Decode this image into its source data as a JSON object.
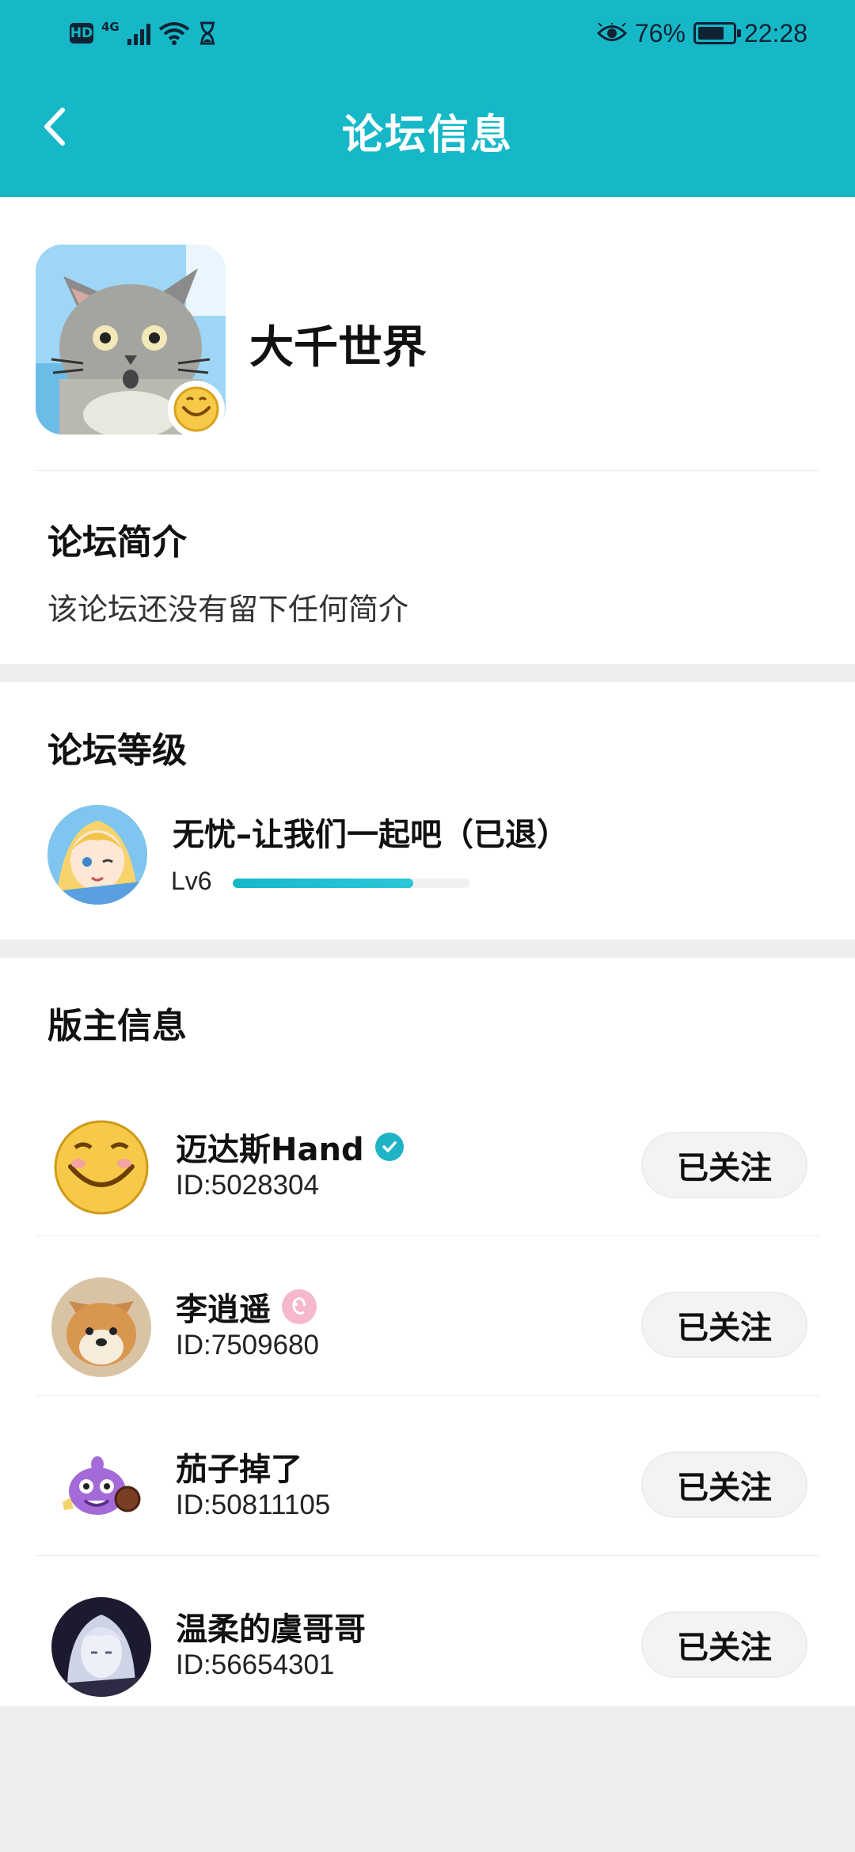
{
  "status_bar": {
    "left_badge": "HD",
    "network": "4G",
    "battery_percent_label": "76%",
    "time": "22:28",
    "battery_level": 0.76
  },
  "header": {
    "title": "论坛信息"
  },
  "forum": {
    "name": "大千世界"
  },
  "intro": {
    "title": "论坛简介",
    "text": "该论坛还没有留下任何简介"
  },
  "level": {
    "title": "论坛等级",
    "name": "无忧–让我们一起吧（已退）",
    "label": "Lv6",
    "progress": 0.76
  },
  "moderators": {
    "title": "版主信息",
    "items": [
      {
        "name": "迈达斯Hand",
        "id": "ID:5028304",
        "button": "已关注",
        "badge": "verified-icon"
      },
      {
        "name": "李逍遥",
        "id": "ID:7509680",
        "button": "已关注",
        "badge": "pink-badge-icon"
      },
      {
        "name": "茄子掉了",
        "id": "ID:50811105",
        "button": "已关注",
        "badge": ""
      },
      {
        "name": "温柔的虞哥哥",
        "id": "ID:56654301",
        "button": "已关注",
        "badge": ""
      }
    ]
  },
  "colors": {
    "accent": "#16b8c8",
    "background": "#eeeeee"
  }
}
